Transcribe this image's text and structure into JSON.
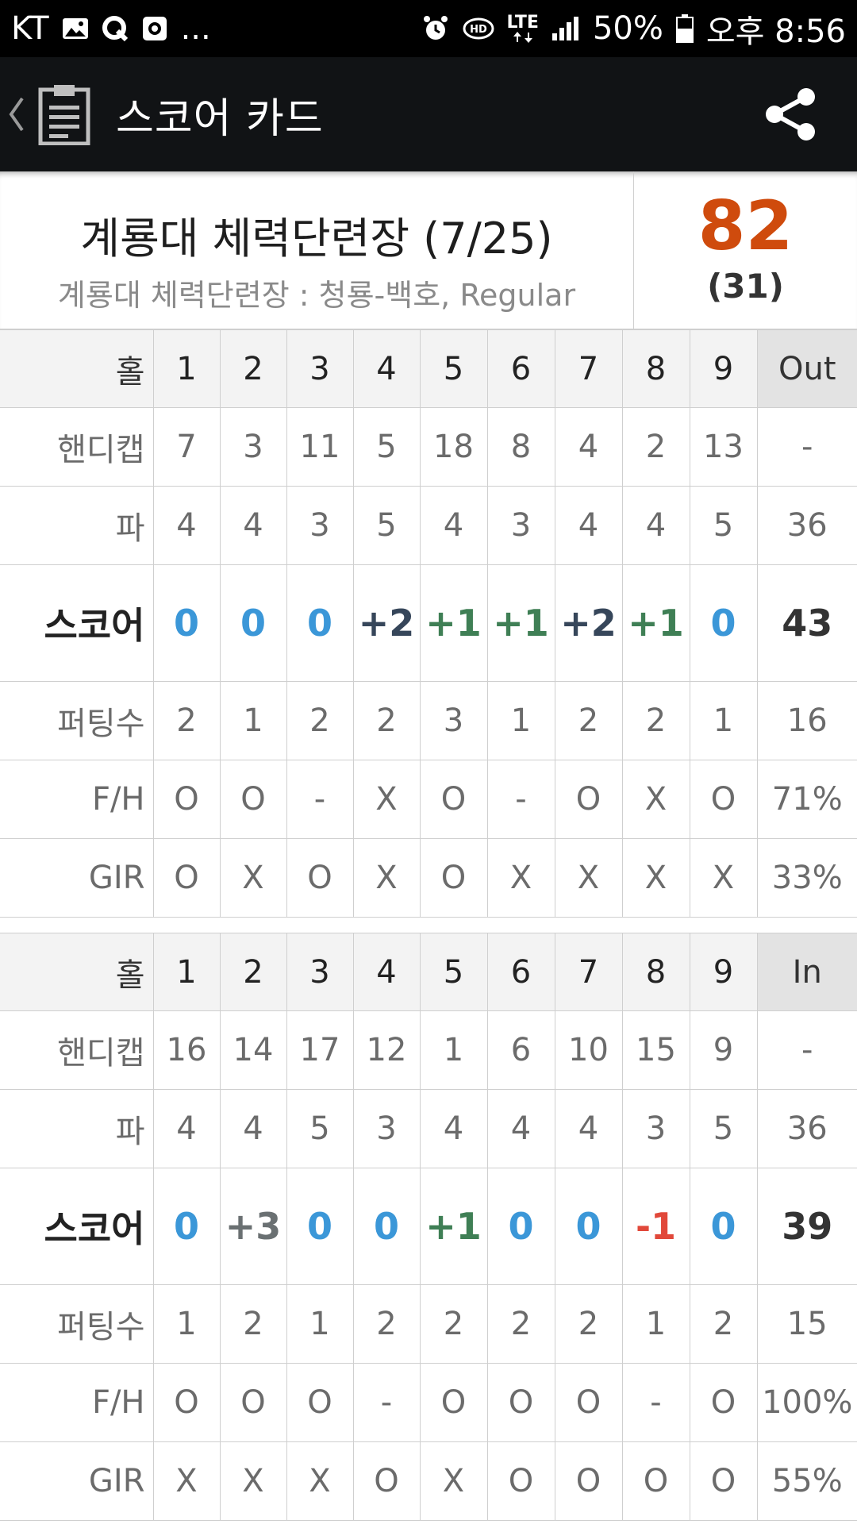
{
  "status_bar": {
    "carrier": "KT",
    "left_icons": [
      "gallery-icon",
      "q-app-icon",
      "record-icon"
    ],
    "more": "...",
    "right_icons": [
      "alarm-icon",
      "hd-icon",
      "lte-icon",
      "signal-icon"
    ],
    "lte": "LTE",
    "battery": "50%",
    "time": "오후 8:56"
  },
  "app_bar": {
    "title": "스코어 카드"
  },
  "course": {
    "name": "계룡대 체력단련장 (7/25)",
    "subtitle": "계룡대 체력단련장 : 청룡-백호, Regular",
    "total_score": "82",
    "total_putts": "(31)"
  },
  "colors": {
    "total_score": "#cf4b0d",
    "par": "#3b97d8",
    "bogey": "#3f7f55",
    "double_bogey": "#36465a",
    "triple_bogey": "#6a7072",
    "birdie": "#e1483a"
  },
  "scorecard": {
    "out": {
      "hole_label": "홀",
      "holes": [
        "1",
        "2",
        "3",
        "4",
        "5",
        "6",
        "7",
        "8",
        "9"
      ],
      "total_label": "Out",
      "handicap_label": "핸디캡",
      "handicap": [
        "7",
        "3",
        "11",
        "5",
        "18",
        "8",
        "4",
        "2",
        "13"
      ],
      "handicap_total": "-",
      "par_label": "파",
      "par": [
        "4",
        "4",
        "3",
        "5",
        "4",
        "3",
        "4",
        "4",
        "5"
      ],
      "par_total": "36",
      "score_label": "스코어",
      "score": [
        "0",
        "0",
        "0",
        "+2",
        "+1",
        "+1",
        "+2",
        "+1",
        "0"
      ],
      "score_total": "43",
      "putts_label": "퍼팅수",
      "putts": [
        "2",
        "1",
        "2",
        "2",
        "3",
        "1",
        "2",
        "2",
        "1"
      ],
      "putts_total": "16",
      "fh_label": "F/H",
      "fh": [
        "O",
        "O",
        "-",
        "X",
        "O",
        "-",
        "O",
        "X",
        "O"
      ],
      "fh_total": "71%",
      "gir_label": "GIR",
      "gir": [
        "O",
        "X",
        "O",
        "X",
        "O",
        "X",
        "X",
        "X",
        "X"
      ],
      "gir_total": "33%"
    },
    "in": {
      "hole_label": "홀",
      "holes": [
        "1",
        "2",
        "3",
        "4",
        "5",
        "6",
        "7",
        "8",
        "9"
      ],
      "total_label": "In",
      "handicap_label": "핸디캡",
      "handicap": [
        "16",
        "14",
        "17",
        "12",
        "1",
        "6",
        "10",
        "15",
        "9"
      ],
      "handicap_total": "-",
      "par_label": "파",
      "par": [
        "4",
        "4",
        "5",
        "3",
        "4",
        "4",
        "4",
        "3",
        "5"
      ],
      "par_total": "36",
      "score_label": "스코어",
      "score": [
        "0",
        "+3",
        "0",
        "0",
        "+1",
        "0",
        "0",
        "-1",
        "0"
      ],
      "score_total": "39",
      "putts_label": "퍼팅수",
      "putts": [
        "1",
        "2",
        "1",
        "2",
        "2",
        "2",
        "2",
        "1",
        "2"
      ],
      "putts_total": "15",
      "fh_label": "F/H",
      "fh": [
        "O",
        "O",
        "O",
        "-",
        "O",
        "O",
        "O",
        "-",
        "O"
      ],
      "fh_total": "100%",
      "gir_label": "GIR",
      "gir": [
        "X",
        "X",
        "X",
        "O",
        "X",
        "O",
        "O",
        "O",
        "O"
      ],
      "gir_total": "55%"
    }
  }
}
